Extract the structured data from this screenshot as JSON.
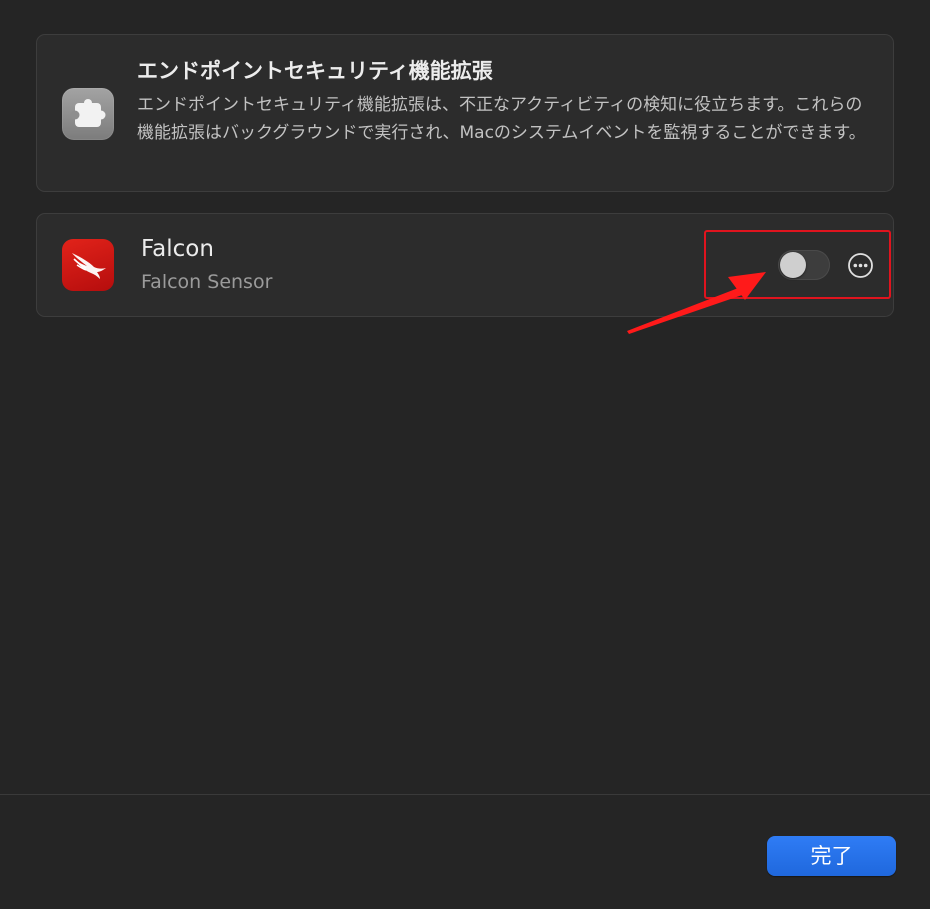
{
  "info": {
    "title": "エンドポイントセキュリティ機能拡張",
    "description": "エンドポイントセキュリティ機能拡張は、不正なアクティビティの検知に役立ちます。これらの機能拡張はバックグラウンドで実行され、Macのシステムイベントを監視することができます。",
    "icon": "extension-puzzle-icon"
  },
  "extension": {
    "name": "Falcon",
    "subtitle": "Falcon Sensor",
    "icon": "falcon-crowdstrike-icon",
    "enabled": false,
    "more_icon": "ellipsis-circle-icon"
  },
  "footer": {
    "done_label": "完了"
  },
  "colors": {
    "background": "#252525",
    "card": "#2c2c2c",
    "accent_button": "#1f6fe5",
    "annotation_red": "#e0141e",
    "falcon_red": "#d71920"
  }
}
